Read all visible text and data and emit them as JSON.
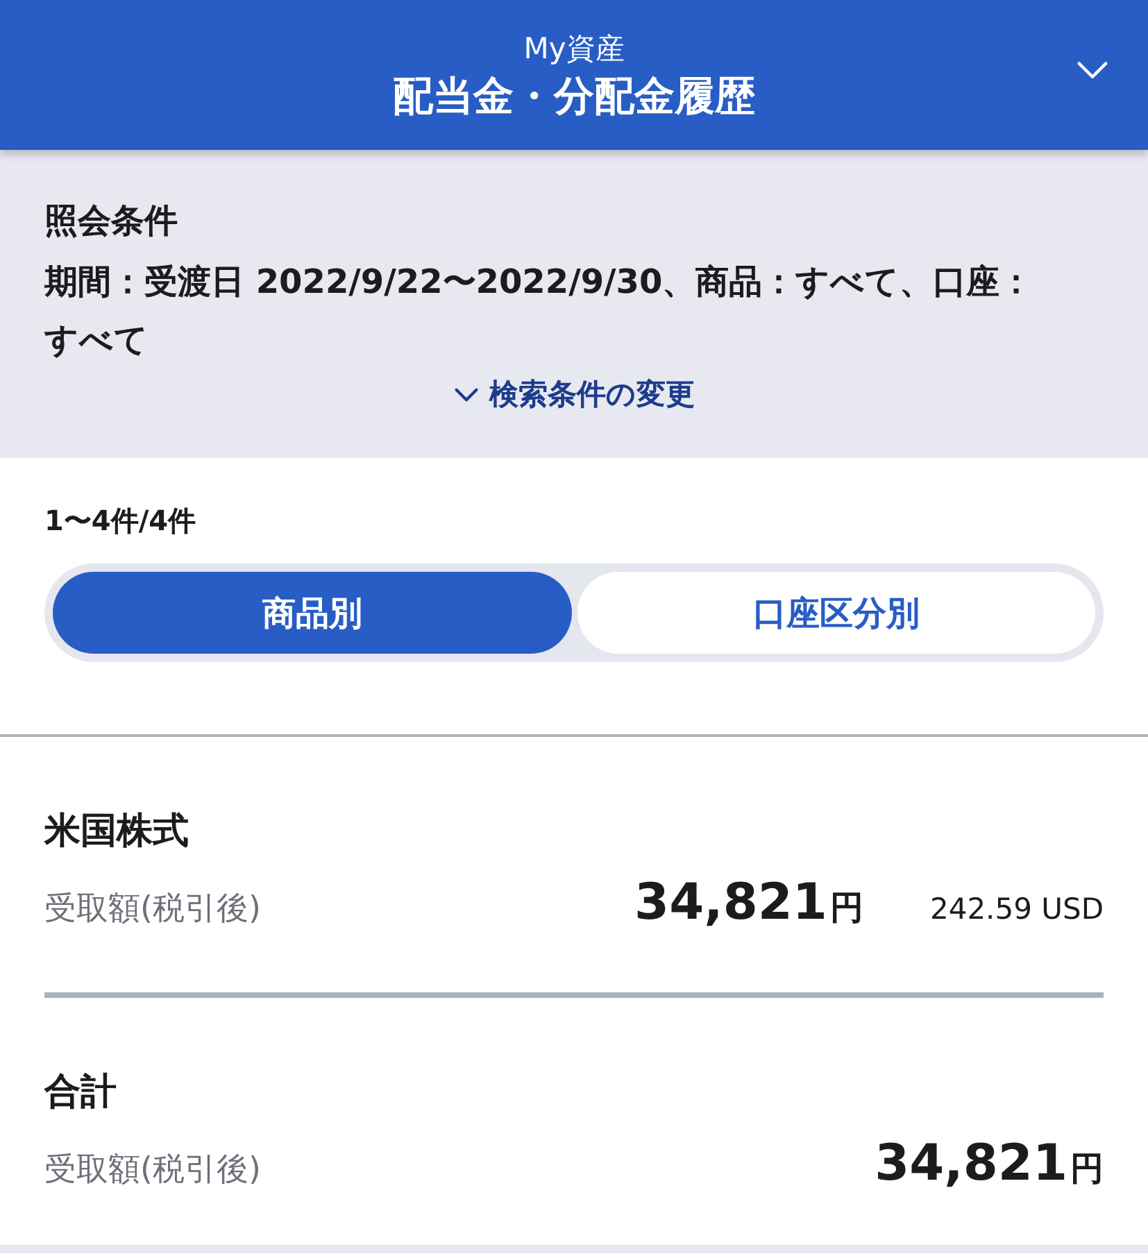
{
  "header": {
    "subtitle": "My資産",
    "title": "配当金・分配金履歴"
  },
  "conditions": {
    "heading": "照会条件",
    "text": "期間：受渡日 2022/9/22〜2022/9/30、商品：すべて、口座：すべて",
    "change_link": "検索条件の変更"
  },
  "result_count": "1〜4件/4件",
  "tabs": [
    {
      "label": "商品別",
      "selected": true
    },
    {
      "label": "口座区分別",
      "selected": false
    }
  ],
  "items": [
    {
      "name": "米国株式",
      "label": "受取額(税引後)",
      "amount": "34,821",
      "unit": "円",
      "foreign_amount": "242.59 USD"
    }
  ],
  "total": {
    "name": "合計",
    "label": "受取額(税引後)",
    "amount": "34,821",
    "unit": "円"
  }
}
